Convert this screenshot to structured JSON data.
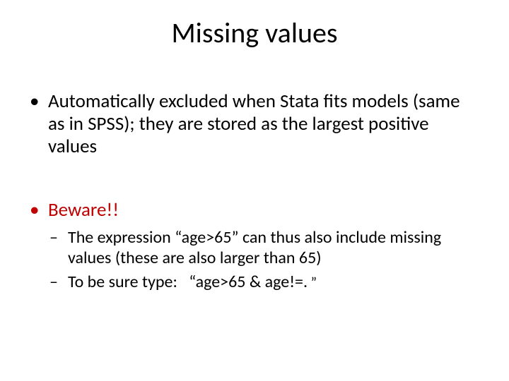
{
  "slide": {
    "title": "Missing values",
    "bullets": {
      "item1": "Automatically excluded when Stata fits models (same as in SPSS); they are stored as the largest positive values",
      "item2": "Beware!!",
      "sub1": "The expression “age>65” can thus also include missing values (these are also larger than 65)",
      "sub2_prefix": "To be sure type:   “age>65 & age!=.",
      "sub2_suffix": " ”"
    }
  }
}
